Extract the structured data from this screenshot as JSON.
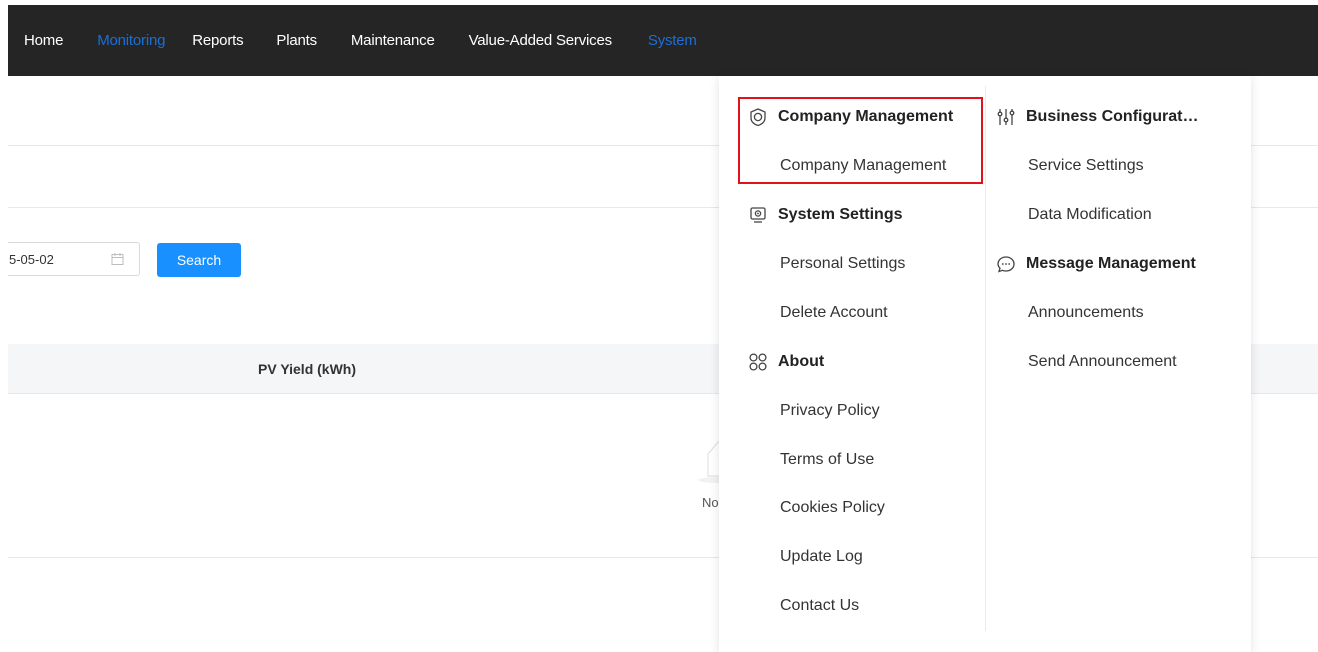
{
  "nav": {
    "home": "Home",
    "monitoring": "Monitoring",
    "reports": "Reports",
    "plants": "Plants",
    "maintenance": "Maintenance",
    "value_added": "Value-Added Services",
    "system": "System"
  },
  "colors": {
    "nav_bg": "#252525",
    "accent": "#1890ff",
    "highlight": "#e0131a"
  },
  "filter": {
    "date_value": "5-05-02",
    "date_icon": "calendar-icon",
    "search_label": "Search"
  },
  "table": {
    "column_pv": "PV Yield (kWh)",
    "empty_text": "No"
  },
  "dropdown": {
    "company_group": "Company Management",
    "company_item": "Company Management",
    "system_group": "System Settings",
    "personal_settings": "Personal Settings",
    "delete_account": "Delete Account",
    "about_group": "About",
    "privacy_policy": "Privacy Policy",
    "terms_of_use": "Terms of Use",
    "cookies_policy": "Cookies Policy",
    "update_log": "Update Log",
    "contact_us": "Contact Us",
    "business_group": "Business Configurat…",
    "service_settings": "Service Settings",
    "data_modification": "Data Modification",
    "message_group": "Message Management",
    "announcements": "Announcements",
    "send_announcement": "Send Announcement"
  }
}
